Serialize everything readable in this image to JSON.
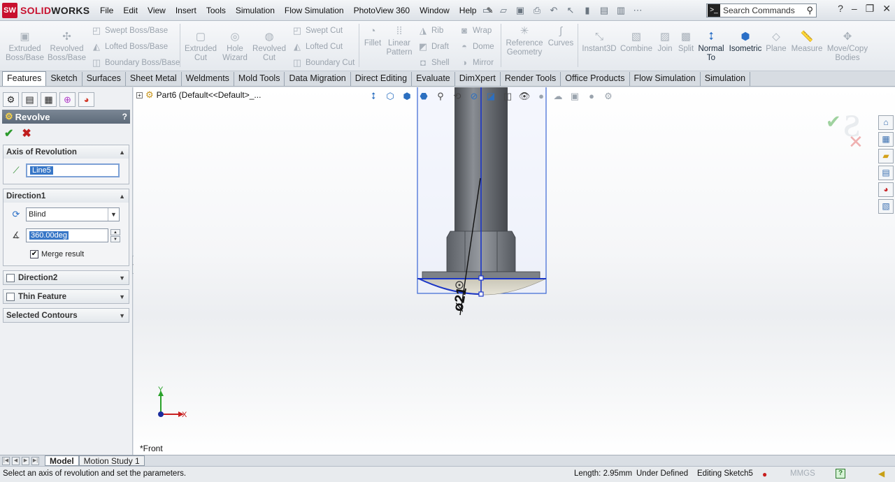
{
  "app": {
    "name_prefix": "SOLID",
    "name_suffix": "WORKS",
    "logo_mark": "SW"
  },
  "menu": [
    "File",
    "Edit",
    "View",
    "Insert",
    "Tools",
    "Simulation",
    "Flow Simulation",
    "PhotoView 360",
    "Window",
    "Help"
  ],
  "search": {
    "placeholder": "Search Commands"
  },
  "commands": {
    "extruded_boss": "Extruded Boss/Base",
    "revolved_boss": "Revolved Boss/Base",
    "swept_boss": "Swept Boss/Base",
    "lofted_boss": "Lofted Boss/Base",
    "boundary_boss": "Boundary Boss/Base",
    "extruded_cut": "Extruded Cut",
    "hole_wizard": "Hole Wizard",
    "revolved_cut": "Revolved Cut",
    "swept_cut": "Swept Cut",
    "lofted_cut": "Lofted Cut",
    "boundary_cut": "Boundary Cut",
    "fillet": "Fillet",
    "linear_pattern": "Linear Pattern",
    "rib": "Rib",
    "draft": "Draft",
    "shell": "Shell",
    "wrap": "Wrap",
    "dome": "Dome",
    "mirror": "Mirror",
    "reference_geometry": "Reference Geometry",
    "curves": "Curves",
    "instant3d": "Instant3D",
    "combine": "Combine",
    "join": "Join",
    "split": "Split",
    "normal_to": "Normal To",
    "isometric": "Isometric",
    "plane": "Plane",
    "measure": "Measure",
    "move_copy": "Move/Copy Bodies"
  },
  "tabs": [
    "Features",
    "Sketch",
    "Surfaces",
    "Sheet Metal",
    "Weldments",
    "Mold Tools",
    "Data Migration",
    "Direct Editing",
    "Evaluate",
    "DimXpert",
    "Render Tools",
    "Office Products",
    "Flow Simulation",
    "Simulation"
  ],
  "active_tab": "Features",
  "property_manager": {
    "title": "Revolve",
    "help": "?",
    "axis_group": {
      "title": "Axis of Revolution",
      "value": "Line5"
    },
    "direction1": {
      "title": "Direction1",
      "end_condition": "Blind",
      "angle": "360.00deg",
      "merge_label": "Merge result",
      "merge_checked": true
    },
    "direction2": {
      "title": "Direction2"
    },
    "thin_feature": {
      "title": "Thin Feature"
    },
    "selected_contours": {
      "title": "Selected Contours"
    }
  },
  "tree": {
    "label": "Part6  (Default<<Default>_..."
  },
  "viewport": {
    "view_name": "*Front",
    "axis_y": "Y",
    "axis_x": "X",
    "dimension_label": "ø21"
  },
  "bottom_tabs": [
    "Model",
    "Motion Study 1"
  ],
  "status": {
    "message": "Select an axis of revolution and set the parameters.",
    "length": "Length: 2.95mm",
    "definition": "Under Defined",
    "editing": "Editing Sketch5",
    "units": "MMGS",
    "help": "?"
  },
  "colors": {
    "accent": "#2a6fc7",
    "title_bar": "#5d6a79",
    "ok": "#2c9a2c",
    "cancel": "#c01e1e",
    "sketch_blue": "#1a35c8",
    "selection_box": "#3a66d4"
  }
}
